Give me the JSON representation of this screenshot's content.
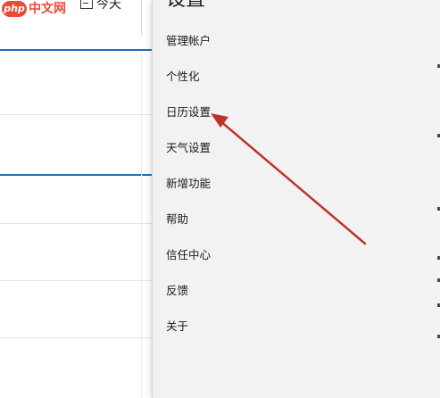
{
  "watermark": {
    "logo_text": "php",
    "text": "中文网"
  },
  "toolbar": {
    "today_label": "今天"
  },
  "settings": {
    "title": "设置",
    "items": [
      {
        "label": "管理帐户"
      },
      {
        "label": "个性化"
      },
      {
        "label": "日历设置"
      },
      {
        "label": "天气设置"
      },
      {
        "label": "新增功能"
      },
      {
        "label": "帮助"
      },
      {
        "label": "信任中心"
      },
      {
        "label": "反馈"
      },
      {
        "label": "关于"
      }
    ]
  },
  "annotation": {
    "color": "#c0312a",
    "points_to": "日历设置"
  },
  "colors": {
    "accent_blue": "#1f6fb2",
    "flyout_bg": "#f2f2f2",
    "watermark_red": "#e84b3a"
  }
}
